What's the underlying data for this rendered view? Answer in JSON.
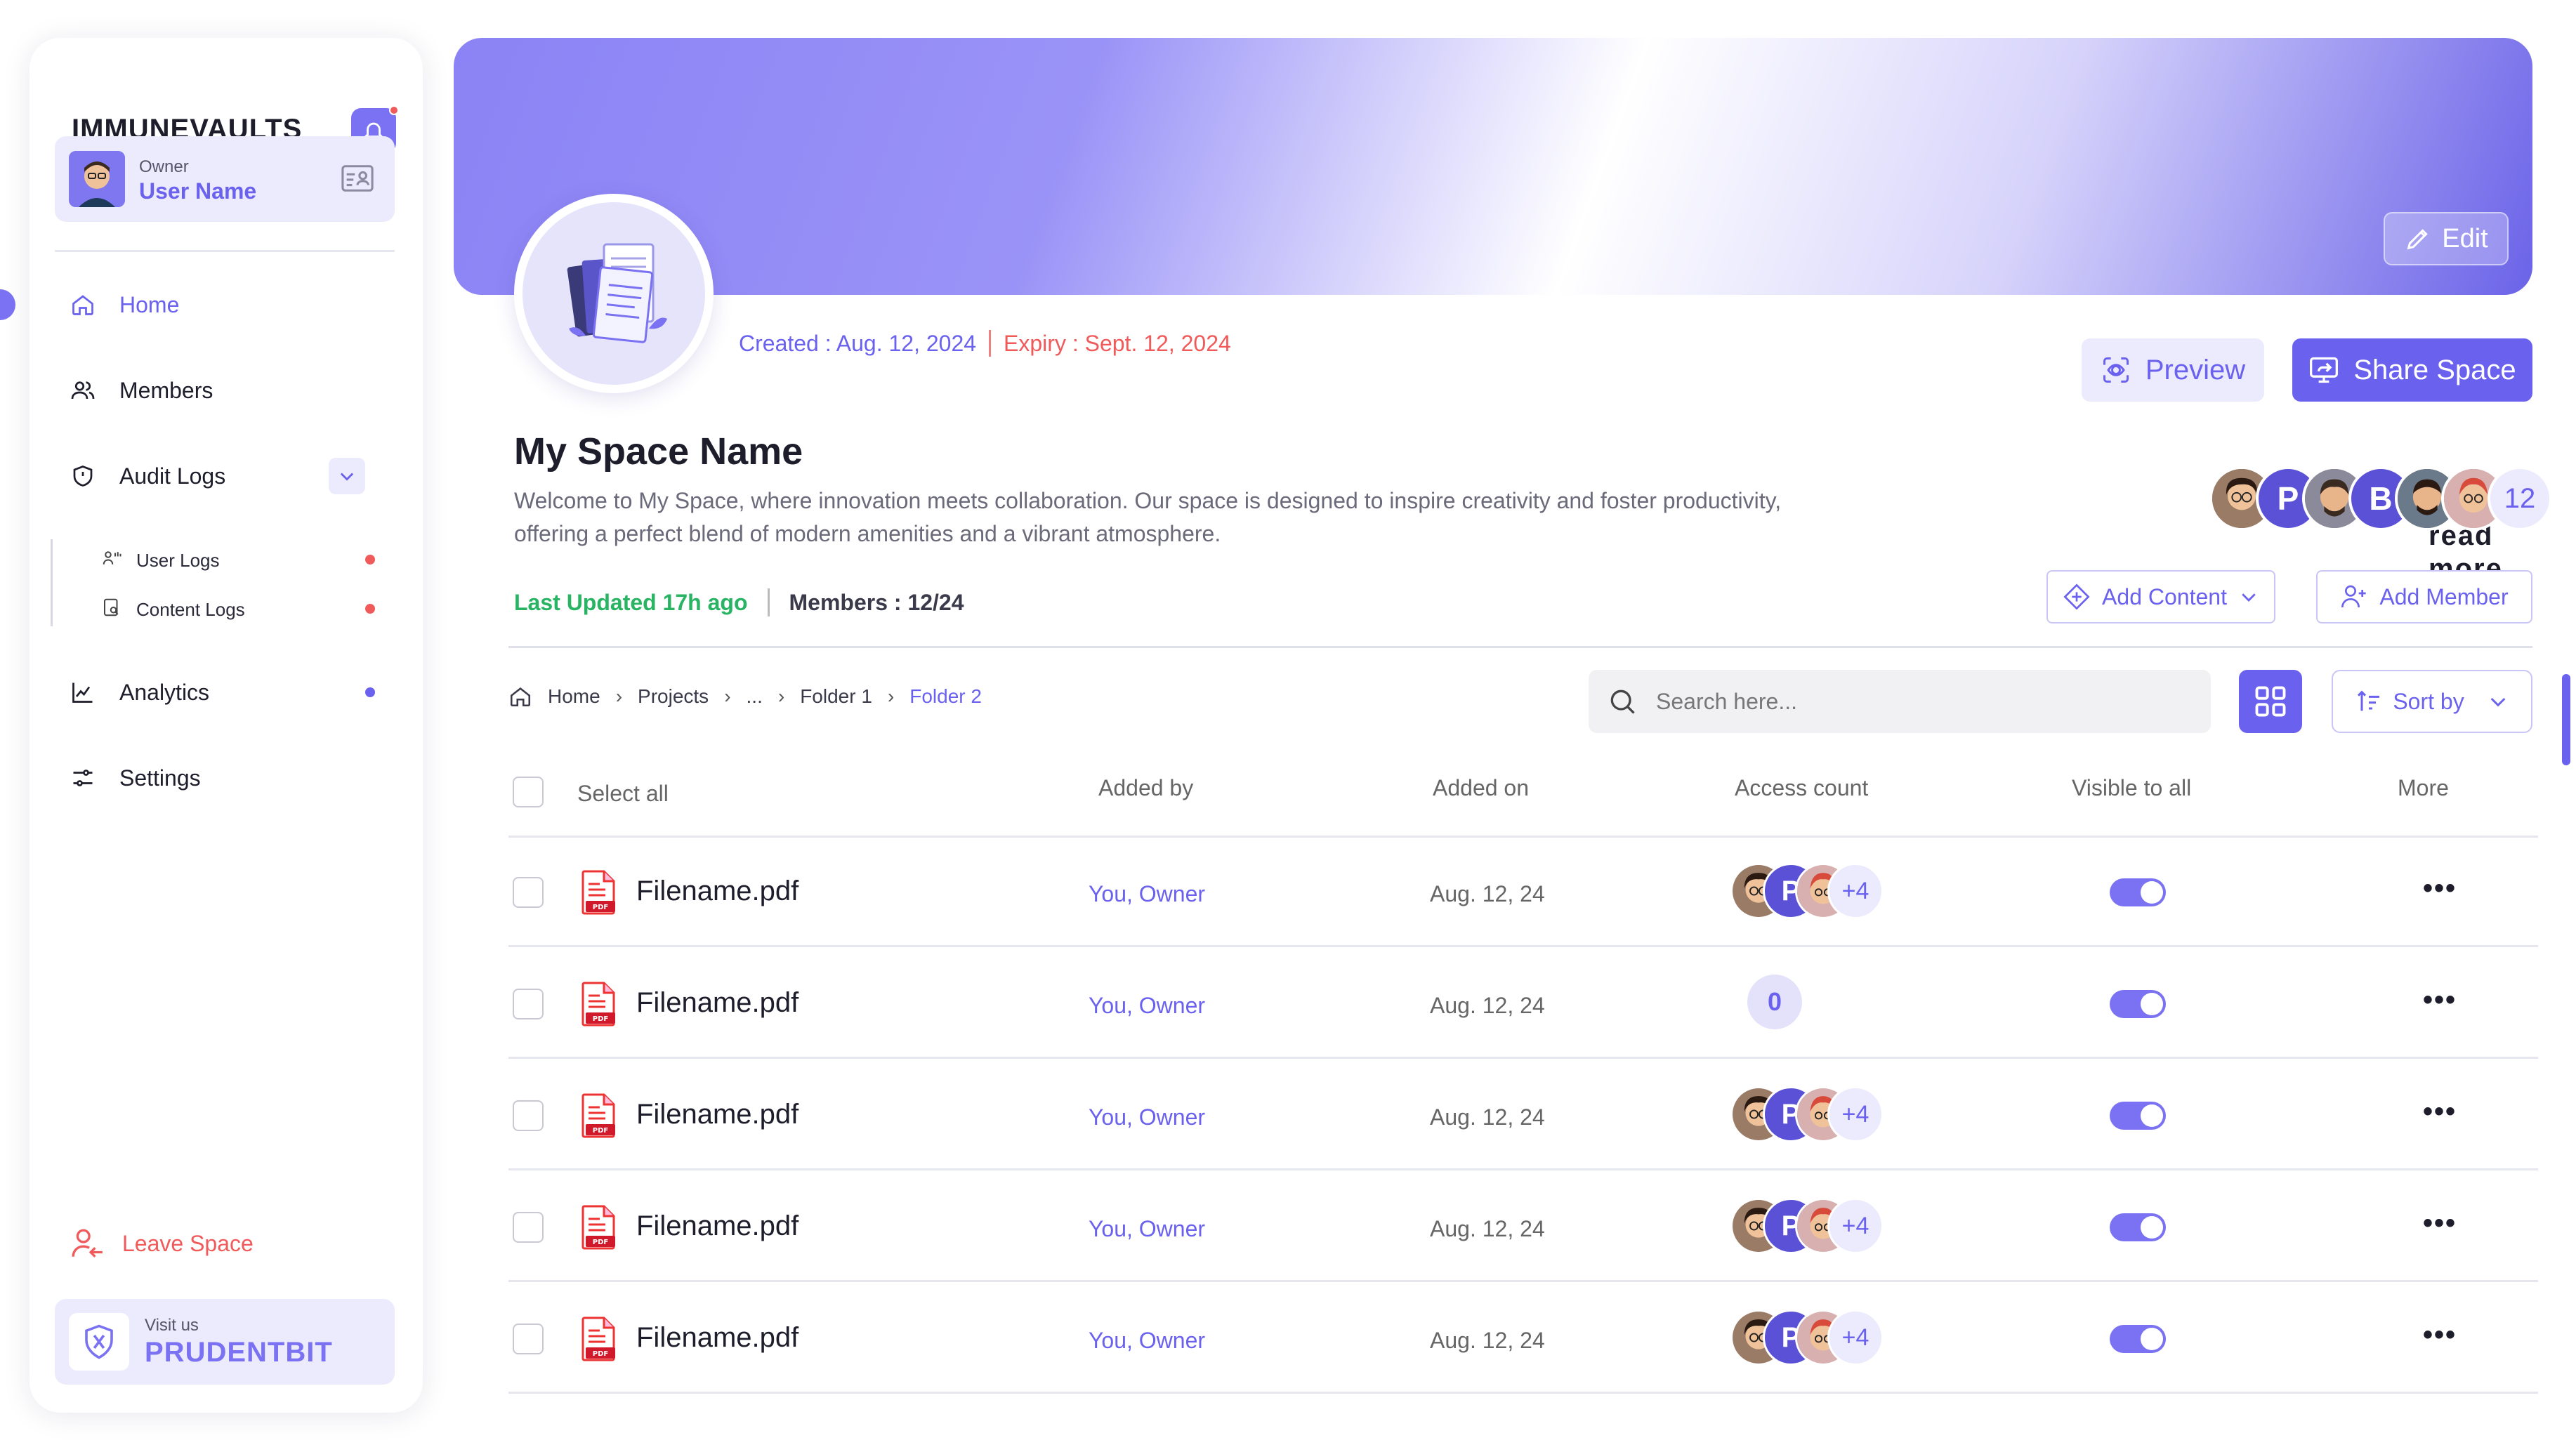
{
  "brand": "IMMUNEVAULTS",
  "owner": {
    "role": "Owner",
    "name": "User Name"
  },
  "nav": {
    "home": "Home",
    "members": "Members",
    "audit_logs": "Audit Logs",
    "user_logs": "User Logs",
    "content_logs": "Content Logs",
    "analytics": "Analytics",
    "settings": "Settings"
  },
  "leave": "Leave Space",
  "visit": {
    "label": "Visit us",
    "name": "PRUDENTBIT"
  },
  "banner": {
    "edit": "Edit"
  },
  "space": {
    "created": "Created : Aug. 12, 2024",
    "expiry": "Expiry : Sept. 12, 2024",
    "title": "My Space Name",
    "description": "Welcome to My Space, where innovation meets collaboration. Our space is designed to inspire creativity and foster productivity, offering a perfect blend of modern amenities and a vibrant atmosphere.",
    "read_more": "read more",
    "last_updated": "Last Updated 17h ago",
    "members_count": "Members : 12/24",
    "member_letters": [
      "P",
      "B"
    ],
    "member_total": "12"
  },
  "actions": {
    "preview": "Preview",
    "share": "Share Space",
    "add_content": "Add Content",
    "add_member": "Add Member",
    "sort_by": "Sort by"
  },
  "breadcrumb": [
    "Home",
    "Projects",
    "...",
    "Folder 1",
    "Folder 2"
  ],
  "search": {
    "placeholder": "Search here..."
  },
  "table": {
    "headers": {
      "select_all": "Select all",
      "added_by": "Added by",
      "added_on": "Added on",
      "access_count": "Access count",
      "visible": "Visible to all",
      "more": "More"
    },
    "rows": [
      {
        "name": "Filename.pdf",
        "added_by": "You, Owner",
        "added_on": "Aug. 12, 24",
        "access": "+4",
        "letter": "P"
      },
      {
        "name": "Filename.pdf",
        "added_by": "You, Owner",
        "added_on": "Aug. 12, 24",
        "access": "0",
        "letter": ""
      },
      {
        "name": "Filename.pdf",
        "added_by": "You, Owner",
        "added_on": "Aug. 12, 24",
        "access": "+4",
        "letter": "P"
      },
      {
        "name": "Filename.pdf",
        "added_by": "You, Owner",
        "added_on": "Aug. 12, 24",
        "access": "+4",
        "letter": "P"
      },
      {
        "name": "Filename.pdf",
        "added_by": "You, Owner",
        "added_on": "Aug. 12, 24",
        "access": "+4",
        "letter": "P"
      }
    ]
  },
  "colors": {
    "accent": "#6a61ef",
    "danger": "#f05a5a",
    "success": "#28b463"
  }
}
